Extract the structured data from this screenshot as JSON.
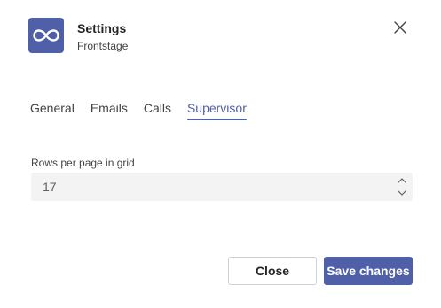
{
  "header": {
    "title": "Settings",
    "subtitle": "Frontstage",
    "logo_icon": "infinity-icon",
    "accent_color": "#4f5fa8"
  },
  "tabs": [
    {
      "label": "General",
      "active": false
    },
    {
      "label": "Emails",
      "active": false
    },
    {
      "label": "Calls",
      "active": false
    },
    {
      "label": "Supervisor",
      "active": true
    }
  ],
  "form": {
    "rows_per_page": {
      "label": "Rows per page in grid",
      "value": "17"
    }
  },
  "footer": {
    "close_label": "Close",
    "save_label": "Save changes"
  }
}
